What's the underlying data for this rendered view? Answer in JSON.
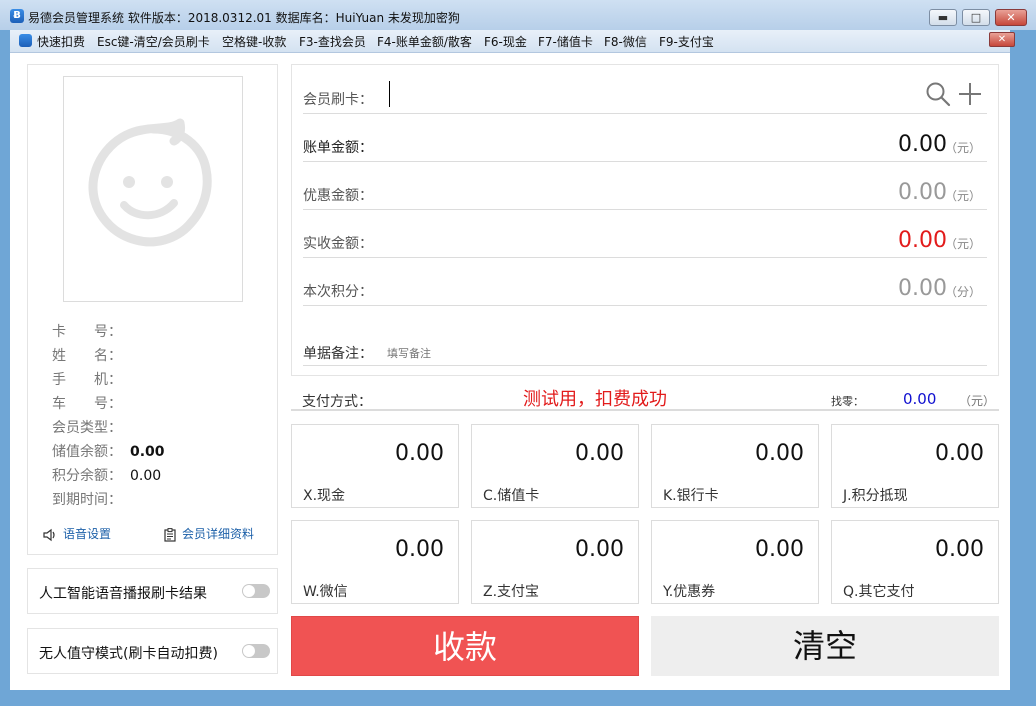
{
  "window": {
    "title": "易德会员管理系统   软件版本：2018.0312.01   数据库名：HuiYuan   未发现加密狗",
    "icon": "app-logo-icon"
  },
  "menu": {
    "items": [
      "快速扣费",
      "Esc键-清空/会员刷卡",
      "空格键-收款",
      "F3-查找会员",
      "F4-账单金额/散客",
      "F6-现金",
      "F7-储值卡",
      "F8-微信",
      "F9-支付宝"
    ]
  },
  "member": {
    "avatar": "smiley-placeholder-icon",
    "fields": [
      {
        "label": "卡　　号：",
        "value": ""
      },
      {
        "label": "姓　　名：",
        "value": ""
      },
      {
        "label": "手　　机：",
        "value": ""
      },
      {
        "label": "车　　号：",
        "value": ""
      },
      {
        "label": "会员类型：",
        "value": ""
      },
      {
        "label": "储值余额：",
        "value": "0.00"
      },
      {
        "label": "积分余额：",
        "value": "0.00"
      },
      {
        "label": "到期时间：",
        "value": ""
      }
    ],
    "voice_settings": "语音设置",
    "member_details": "会员详细资料"
  },
  "toggles": {
    "ai_voice": {
      "label": "人工智能语音播报刷卡结果",
      "on": false
    },
    "unattended": {
      "label": "无人值守模式(刷卡自动扣费)",
      "on": false
    }
  },
  "form": {
    "card_label": "会员刷卡：",
    "card_value": "",
    "bill_label": "账单金额：",
    "bill_amount": "0.00",
    "discount_label": "优惠金额：",
    "discount_amount": "0.00",
    "received_label": "实收金额：",
    "received_amount": "0.00",
    "points_label": "本次积分：",
    "points_amount": "0.00",
    "unit_yuan": "（元）",
    "unit_fen": "（分）",
    "note_label": "单据备注：",
    "note_placeholder": "填写备注"
  },
  "payment": {
    "label": "支付方式：",
    "message": "测试用，扣费成功",
    "change_label": "找零：",
    "change_value": "0.00",
    "change_unit": "（元）",
    "methods": [
      {
        "name": "X.现金",
        "amount": "0.00"
      },
      {
        "name": "C.储值卡",
        "amount": "0.00"
      },
      {
        "name": "K.银行卡",
        "amount": "0.00"
      },
      {
        "name": "J.积分抵现",
        "amount": "0.00"
      },
      {
        "name": "W.微信",
        "amount": "0.00"
      },
      {
        "name": "Z.支付宝",
        "amount": "0.00"
      },
      {
        "name": "Y.优惠券",
        "amount": "0.00"
      },
      {
        "name": "Q.其它支付",
        "amount": "0.00"
      }
    ]
  },
  "actions": {
    "collect": "收款",
    "clear": "清空"
  },
  "colors": {
    "collect_bg": "#f05353",
    "received_amount": "#e21b1b",
    "message": "#e21b1b",
    "change_value": "#1010d0",
    "link": "#1b5fa8"
  }
}
